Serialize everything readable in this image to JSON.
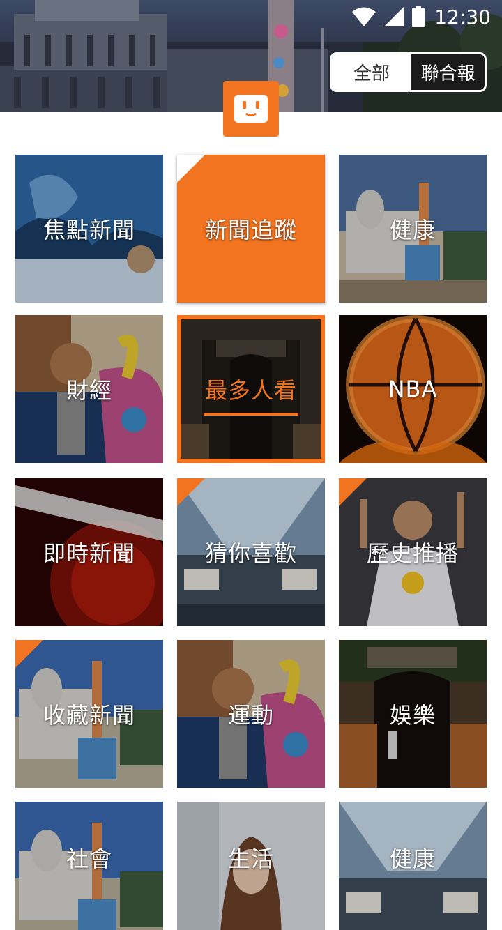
{
  "status_bar": {
    "time": "12:30"
  },
  "header": {
    "segment_all": "全部",
    "segment_udn": "聯合報"
  },
  "colors": {
    "accent": "#f27420"
  },
  "tiles": [
    {
      "label": "焦點新聞",
      "style": "photo",
      "corner": false
    },
    {
      "label": "新聞追蹤",
      "style": "orange",
      "corner": true
    },
    {
      "label": "健康",
      "style": "photo",
      "corner": false
    },
    {
      "label": "財經",
      "style": "photo",
      "corner": false
    },
    {
      "label": "最多人看",
      "style": "selected",
      "corner": false
    },
    {
      "label": "NBA",
      "style": "photo",
      "corner": false
    },
    {
      "label": "即時新聞",
      "style": "photo",
      "corner": false
    },
    {
      "label": "猜你喜歡",
      "style": "photo",
      "corner": true
    },
    {
      "label": "歷史推播",
      "style": "photo",
      "corner": true
    },
    {
      "label": "收藏新聞",
      "style": "photo",
      "corner": true
    },
    {
      "label": "運動",
      "style": "photo",
      "corner": false
    },
    {
      "label": "娛樂",
      "style": "photo",
      "corner": false
    },
    {
      "label": "社會",
      "style": "photo",
      "corner": false
    },
    {
      "label": "生活",
      "style": "photo",
      "corner": false
    },
    {
      "label": "健康",
      "style": "photo",
      "corner": false
    }
  ],
  "icons": {
    "wifi": "wifi-icon",
    "signal": "cell-signal-icon",
    "battery": "battery-icon",
    "logo": "app-logo-icon"
  }
}
